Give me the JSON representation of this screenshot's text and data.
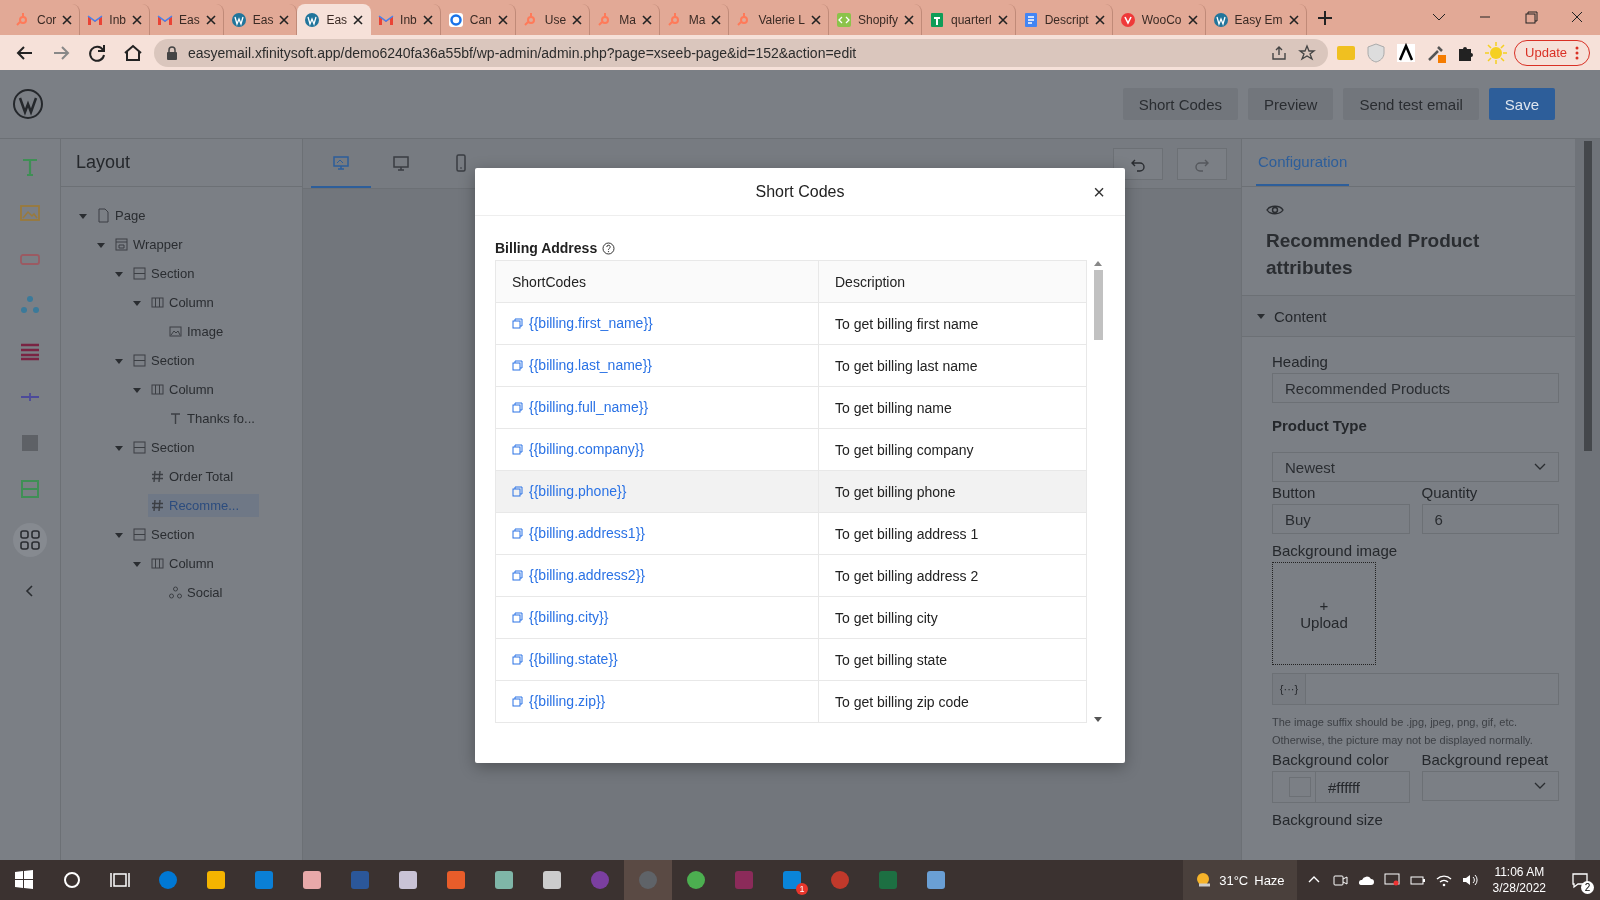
{
  "browser": {
    "tabs": [
      {
        "title": "Cor",
        "kind": "hubspot",
        "selected": false
      },
      {
        "title": "Inb",
        "kind": "gmail",
        "selected": false
      },
      {
        "title": "Eas",
        "kind": "gmail",
        "selected": false
      },
      {
        "title": "Eas",
        "kind": "wordpress",
        "selected": false
      },
      {
        "title": "Eas",
        "kind": "wordpress",
        "selected": true
      },
      {
        "title": "Inb",
        "kind": "gmail",
        "selected": false
      },
      {
        "title": "Can",
        "kind": "ring",
        "selected": false
      },
      {
        "title": "Use",
        "kind": "hubspot",
        "selected": false
      },
      {
        "title": "Ma",
        "kind": "hubspot",
        "selected": false
      },
      {
        "title": "Ma",
        "kind": "hubspot",
        "selected": false
      },
      {
        "title": "Valerie L",
        "kind": "hubspot",
        "selected": false
      },
      {
        "title": "Shopify",
        "kind": "code",
        "selected": false
      },
      {
        "title": "quarterl",
        "kind": "sheet",
        "selected": false
      },
      {
        "title": "Descript",
        "kind": "doc",
        "selected": false
      },
      {
        "title": "WooCo",
        "kind": "vivaldi",
        "selected": false
      },
      {
        "title": "Easy Em",
        "kind": "wordpress",
        "selected": false
      }
    ],
    "url": "easyemail.xfinitysoft.app/demo6240fa36a55bf/wp-admin/admin.php?page=xseeb-page&id=152&action=edit",
    "update_label": "Update"
  },
  "header": {
    "buttons": [
      {
        "label": "Short Codes",
        "kind": "default"
      },
      {
        "label": "Preview",
        "kind": "default"
      },
      {
        "label": "Send test email",
        "kind": "default"
      },
      {
        "label": "Save",
        "kind": "primary"
      }
    ]
  },
  "layout_panel": {
    "title": "Layout",
    "tree": [
      {
        "label": "Page",
        "kind": "page",
        "expanded": true,
        "selected": false,
        "children": [
          {
            "label": "Wrapper",
            "kind": "wrapper",
            "expanded": true,
            "selected": false,
            "children": [
              {
                "label": "Section",
                "kind": "section",
                "expanded": true,
                "selected": false,
                "children": [
                  {
                    "label": "Column",
                    "kind": "column",
                    "expanded": true,
                    "selected": false,
                    "children": [
                      {
                        "label": "Image",
                        "kind": "image",
                        "selected": false
                      }
                    ]
                  }
                ]
              },
              {
                "label": "Section",
                "kind": "section",
                "expanded": true,
                "selected": false,
                "children": [
                  {
                    "label": "Column",
                    "kind": "column",
                    "expanded": true,
                    "selected": false,
                    "children": [
                      {
                        "label": "Thanks fo...",
                        "kind": "text",
                        "selected": false
                      }
                    ]
                  }
                ]
              },
              {
                "label": "Section",
                "kind": "section",
                "expanded": true,
                "selected": false,
                "children": [
                  {
                    "label": "Order Total",
                    "kind": "hash",
                    "selected": false
                  },
                  {
                    "label": "Recomme...",
                    "kind": "hash",
                    "selected": true
                  }
                ]
              },
              {
                "label": "Section",
                "kind": "section",
                "expanded": true,
                "selected": false,
                "children": [
                  {
                    "label": "Column",
                    "kind": "column",
                    "expanded": true,
                    "selected": false,
                    "children": [
                      {
                        "label": "Social",
                        "kind": "social",
                        "selected": false
                      }
                    ]
                  }
                ]
              }
            ]
          }
        ]
      }
    ]
  },
  "canvas": {
    "device_tabs": [
      {
        "kind": "desktop",
        "selected": true
      },
      {
        "kind": "monitor",
        "selected": false
      },
      {
        "kind": "phone",
        "selected": false
      }
    ]
  },
  "config_panel": {
    "tabs": [
      {
        "label": "Configuration",
        "selected": true
      }
    ],
    "heading": "Recommended Product attributes",
    "section": {
      "title": "Content",
      "expanded": true
    },
    "heading_field": {
      "label": "Heading",
      "value": "Recommended Products"
    },
    "product_type": {
      "label": "Product Type",
      "value": "Newest"
    },
    "button_field": {
      "label": "Button",
      "value": "Buy"
    },
    "quantity_field": {
      "label": "Quantity",
      "value": "6"
    },
    "background_image": {
      "label": "Background image",
      "upload_plus": "+",
      "upload_label": "Upload",
      "variable_prefix": "{···}",
      "hint": "The image suffix should be .jpg, jpeg, png, gif, etc. Otherwise, the picture may not be displayed normally."
    },
    "background_color": {
      "label": "Background color",
      "value": "#ffffff"
    },
    "background_repeat": {
      "label": "Background repeat"
    },
    "background_size": {
      "label": "Background size"
    }
  },
  "modal": {
    "title": "Short Codes",
    "close": "×",
    "section_title": "Billing Address",
    "columns": [
      "ShortCodes",
      "Description"
    ],
    "rows": [
      {
        "code": "{{billing.first_name}}",
        "description": "To get billing first name",
        "highlighted": false
      },
      {
        "code": "{{billing.last_name}}",
        "description": "To get billing last name",
        "highlighted": false
      },
      {
        "code": "{{billing.full_name}}",
        "description": "To get billing name",
        "highlighted": false
      },
      {
        "code": "{{billing.company}}",
        "description": "To get billing company",
        "highlighted": false
      },
      {
        "code": "{{billing.phone}}",
        "description": "To get billing phone",
        "highlighted": true
      },
      {
        "code": "{{billing.address1}}",
        "description": "To get billing address 1",
        "highlighted": false
      },
      {
        "code": "{{billing.address2}}",
        "description": "To get billing address 2",
        "highlighted": false
      },
      {
        "code": "{{billing.city}}",
        "description": "To get billing city",
        "highlighted": false
      },
      {
        "code": "{{billing.state}}",
        "description": "To get billing state",
        "highlighted": false
      },
      {
        "code": "{{billing.zip}}",
        "description": "To get billing zip code",
        "highlighted": false
      }
    ]
  },
  "taskbar": {
    "skype_badge": "1",
    "temperature": "31°C",
    "weather": "Haze",
    "time": "11:06 AM",
    "date": "3/28/2022",
    "notification_count": "2"
  }
}
